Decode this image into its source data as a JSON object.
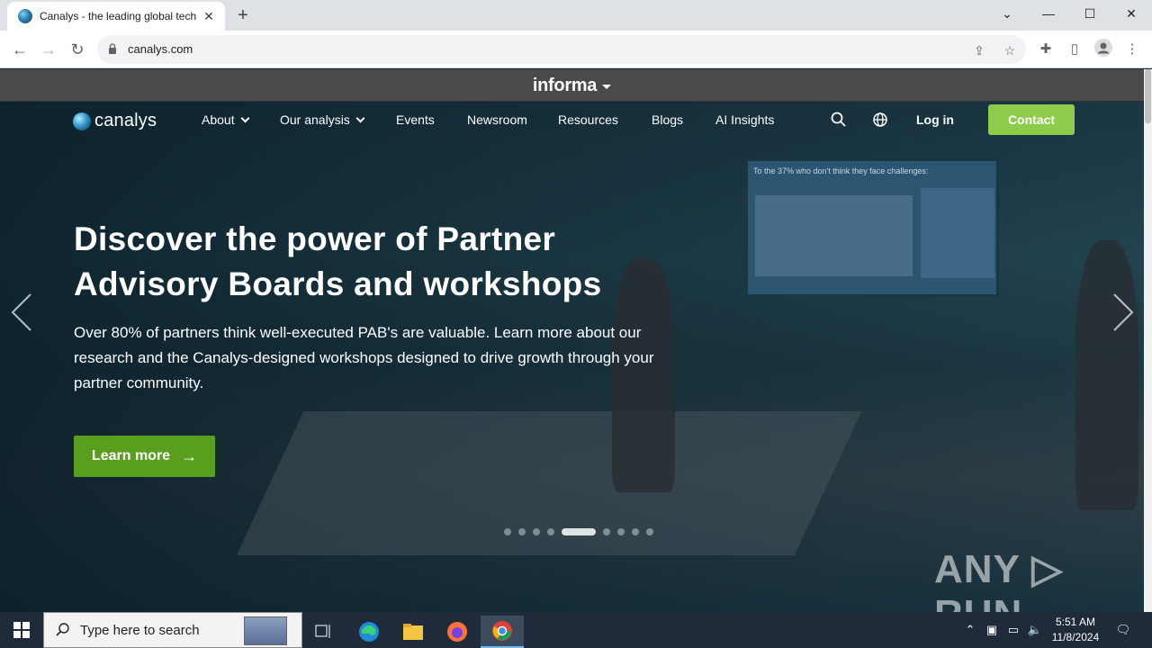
{
  "browser": {
    "tab_title": "Canalys - the leading global tech",
    "url": "canalys.com",
    "new_tab_label": "+",
    "window_controls": [
      "—",
      "☐",
      "✕"
    ]
  },
  "site": {
    "network_brand": "informa",
    "brand": "canalys",
    "nav": {
      "about": "About",
      "our_analysis": "Our analysis",
      "events": "Events",
      "newsroom": "Newsroom",
      "resources": "Resources",
      "blogs": "Blogs",
      "ai_insights": "AI Insights",
      "login": "Log in",
      "contact": "Contact"
    },
    "hero": {
      "headline": "Discover the power of Partner Advisory Boards and workshops",
      "subtext": "Over 80% of partners think well-executed PAB's are valuable. Learn more about our research and the Canalys-designed workshops designed to drive growth through your partner community.",
      "cta": "Learn more",
      "cta_arrow": "→",
      "slide_count": 9,
      "active_slide": 5
    },
    "screen_text": "To the 37% who don't think they face challenges:"
  },
  "watermark": "ANY ▷ RUN",
  "taskbar": {
    "search_placeholder": "Type here to search",
    "time": "5:51 AM",
    "date": "11/8/2024"
  },
  "colors": {
    "contact_button": "#8dcb4a",
    "cta_button": "#5a9e1e",
    "informa_bar": "#4a4a4a"
  }
}
